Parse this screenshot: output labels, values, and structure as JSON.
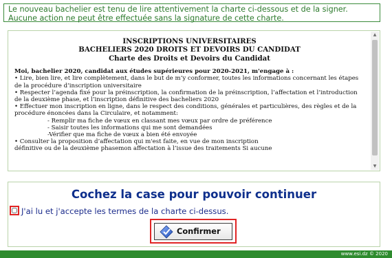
{
  "notice": {
    "text": "Le nouveau bachelier est tenu de lire attentivement la charte ci-dessous et de la signer. Aucune action ne peut être effectuée sans la signature de cette charte."
  },
  "charter": {
    "title_line1": "INSCRIPTIONS UNIVERSITAIRES",
    "title_line2": "BACHELIERS 2020 DROITS ET DEVOIRS DU CANDIDAT",
    "title_line3": "Charte des Droits et Devoirs du Candidat",
    "intro": "Moi, bachelier 2020, candidat aux études supérieures pour 2020-2021, m'engage à :",
    "lines": [
      "• Lire, bien lire, et lire complètement, dans le but de m’y conformer, toutes les informations concernant les étapes de la procédure d’inscription universitaire",
      "• Respecter l’agenda fixé pour la préinscription, la confirmation de la préinscription, l’affectation et l’introduction de la deuxième phase, et l’inscription définitive des bacheliers 2020",
      "• Effectuer mon inscription en ligne, dans le respect des conditions, générales et particulières, des règles et de la procédure énoncées dans la Circulaire, et notamment:"
    ],
    "sublines": [
      "- Remplir ma fiche de vœux en classant mes vœux par ordre de préférence",
      "- Saisir toutes les informations qui me sont demandées",
      "-Vérifier que ma fiche de vœux a bien été envoyée"
    ],
    "line4": "• Consulter la proposition d’affectation qui m'est faite, en vue de mon inscription",
    "line5": "définitive ou de la deuxième phasemon affectation à l’issue des traitements Si aucune"
  },
  "accept": {
    "title": "Cochez la case pour pouvoir continuer",
    "checkbox_label": "J'ai lu et j'accepte les termes de la charte ci-dessus.",
    "checked": false,
    "confirm_label": "Confirmer",
    "confirm_icon": "diamond-check-icon"
  },
  "footer": {
    "text": "www.esi.dz © 2020"
  },
  "colors": {
    "brand_green": "#2e8b2e",
    "notice_text": "#2c7a2c",
    "title_blue": "#0e2f8c",
    "highlight_red": "#e02424"
  }
}
